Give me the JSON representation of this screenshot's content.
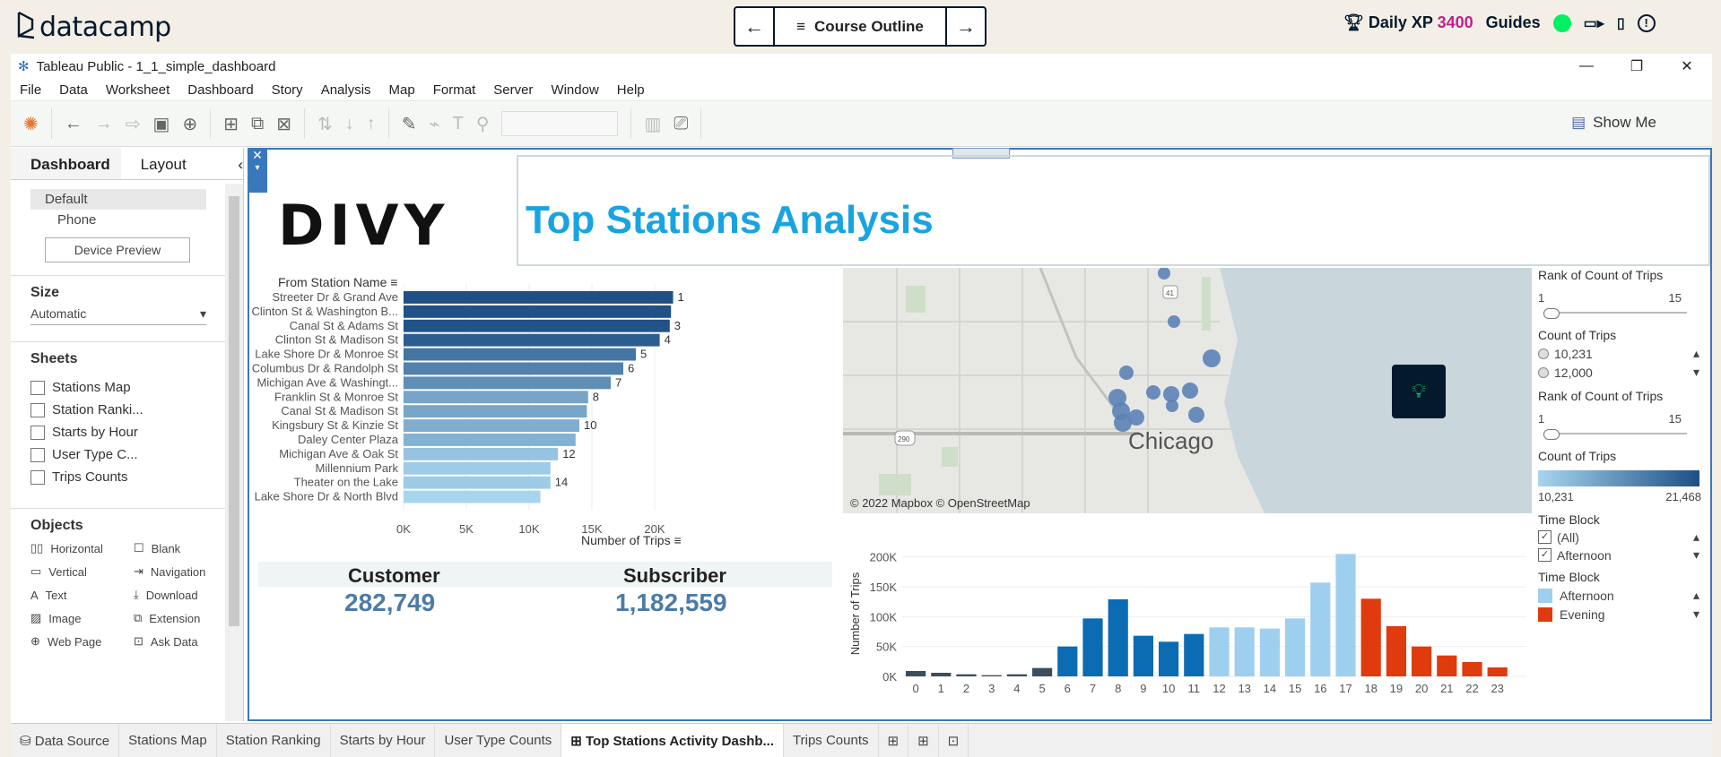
{
  "datacamp": {
    "logo_text": "datacamp",
    "nav_prev": "←",
    "nav_label": "Course Outline",
    "nav_next": "→",
    "xp_label": "Daily XP",
    "xp_value": "3400",
    "guides": "Guides"
  },
  "window": {
    "title": "Tableau Public - 1_1_simple_dashboard",
    "menu": [
      "File",
      "Data",
      "Worksheet",
      "Dashboard",
      "Story",
      "Analysis",
      "Map",
      "Format",
      "Server",
      "Window",
      "Help"
    ],
    "show_me": "Show Me"
  },
  "sidebar": {
    "tabs": [
      "Dashboard",
      "Layout"
    ],
    "device_options": [
      "Default",
      "Phone"
    ],
    "device_preview": "Device Preview",
    "size_heading": "Size",
    "size_value": "Automatic",
    "sheets_heading": "Sheets",
    "sheets": [
      "Stations Map",
      "Station Ranki...",
      "Starts by Hour",
      "User Type C...",
      "Trips Counts"
    ],
    "objects_heading": "Objects",
    "objects": [
      "Horizontal",
      "Blank",
      "Vertical",
      "Navigation",
      "Text",
      "Download",
      "Image",
      "Extension",
      "Web Page",
      "Ask Data"
    ]
  },
  "dashboard": {
    "logo_text": "DIVY",
    "title": "Top Stations Analysis",
    "bar_header": "From Station Name",
    "bar_xlabel": "Number of Trips",
    "kpi": [
      {
        "label": "Customer",
        "value": "282,749"
      },
      {
        "label": "Subscriber",
        "value": "1,182,559"
      }
    ],
    "map_attribution": "© 2022 Mapbox © OpenStreetMap",
    "map_city": "Chicago",
    "map_highways": [
      "41",
      "290"
    ],
    "lamp_icon": "lightbulb-icon",
    "legend": {
      "rank1_title": "Rank of Count of Trips",
      "rank1_min": "1",
      "rank1_max": "15",
      "count_title": "Count of Trips",
      "count_options": [
        "10,231",
        "12,000"
      ],
      "rank2_title": "Rank of Count of Trips",
      "rank2_min": "1",
      "rank2_max": "15",
      "count2_title": "Count of Trips",
      "gradient_min": "10,231",
      "gradient_max": "21,468",
      "timeblock_title": "Time Block",
      "timeblock_options": [
        "(All)",
        "Afternoon"
      ],
      "timeblock2_title": "Time Block",
      "timeblock_swatches": [
        {
          "label": "Afternoon",
          "color": "#9fcfee"
        },
        {
          "label": "Evening",
          "color": "#e03a0f"
        }
      ]
    }
  },
  "bottom_tabs": [
    "Data Source",
    "Stations Map",
    "Station Ranking",
    "Starts by Hour",
    "User Type Counts",
    "Top Stations Activity Dashb...",
    "Trips Counts"
  ],
  "chart_data": [
    {
      "type": "bar",
      "orientation": "horizontal",
      "categories": [
        "Streeter Dr & Grand Ave",
        "Clinton St & Washington B...",
        "Canal St & Adams St",
        "Clinton St & Madison St",
        "Lake Shore Dr & Monroe St",
        "Columbus Dr & Randolph St",
        "Michigan Ave & Washingt...",
        "Franklin St & Monroe St",
        "Canal St & Madison St",
        "Kingsbury St & Kinzie St",
        "Daley Center Plaza",
        "Michigan Ave & Oak St",
        "Millennium Park",
        "Theater on the Lake",
        "Lake Shore Dr & North Blvd"
      ],
      "values": [
        21468,
        21300,
        21200,
        20400,
        18500,
        17500,
        16500,
        14700,
        14600,
        14000,
        13700,
        12300,
        11700,
        11700,
        10900
      ],
      "data_labels": [
        "1",
        "",
        "3",
        "4",
        "5",
        "6",
        "7",
        "8",
        "",
        "10",
        "",
        "12",
        "",
        "14",
        ""
      ],
      "xlabel": "Number of Trips",
      "xticks": [
        "0K",
        "5K",
        "10K",
        "15K",
        "20K"
      ],
      "xlim": [
        0,
        22000
      ],
      "color_scale": [
        "#a8d5ee",
        "#1e4f85"
      ]
    },
    {
      "type": "bar",
      "categories": [
        "0",
        "1",
        "2",
        "3",
        "4",
        "5",
        "6",
        "7",
        "8",
        "9",
        "10",
        "11",
        "12",
        "13",
        "14",
        "15",
        "16",
        "17",
        "18",
        "19",
        "20",
        "21",
        "22",
        "23"
      ],
      "values": [
        9000,
        6000,
        3500,
        2000,
        3500,
        14000,
        50000,
        97000,
        129000,
        68000,
        58000,
        71000,
        82000,
        82000,
        80000,
        97000,
        157000,
        205000,
        130000,
        84000,
        50000,
        35000,
        24000,
        15000
      ],
      "colors": [
        "#3a4e5e",
        "#3a4e5e",
        "#3a4e5e",
        "#3a4e5e",
        "#3a4e5e",
        "#3a4e5e",
        "#0b6bb3",
        "#0b6bb3",
        "#0b6bb3",
        "#0b6bb3",
        "#0b6bb3",
        "#0b6bb3",
        "#9fcfee",
        "#9fcfee",
        "#9fcfee",
        "#9fcfee",
        "#9fcfee",
        "#9fcfee",
        "#e03a0f",
        "#e03a0f",
        "#e03a0f",
        "#e03a0f",
        "#e03a0f",
        "#e03a0f"
      ],
      "ylabel": "Number of Trips",
      "yticks": [
        "0K",
        "50K",
        "100K",
        "150K",
        "200K"
      ],
      "ylim": [
        0,
        210000
      ]
    }
  ]
}
